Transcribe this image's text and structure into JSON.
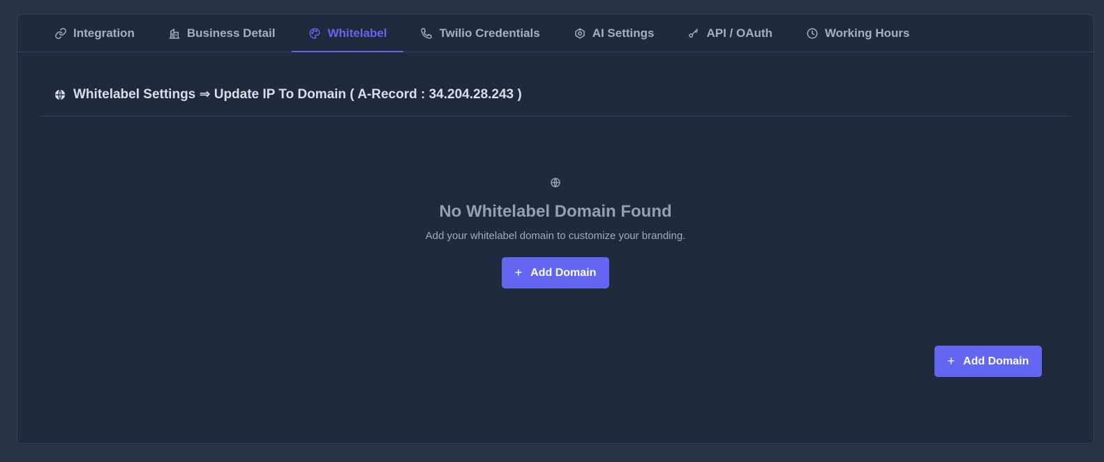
{
  "tabs": [
    {
      "label": "Integration",
      "icon": "link-icon"
    },
    {
      "label": "Business Detail",
      "icon": "building-icon"
    },
    {
      "label": "Whitelabel",
      "icon": "palette-icon"
    },
    {
      "label": "Twilio Credentials",
      "icon": "phone-icon"
    },
    {
      "label": "AI Settings",
      "icon": "robot-icon"
    },
    {
      "label": "API / OAuth",
      "icon": "key-icon"
    },
    {
      "label": "Working Hours",
      "icon": "clock-icon"
    }
  ],
  "active_tab": "Whitelabel",
  "section": {
    "title": "Whitelabel Settings ⇒ Update IP To Domain ( A-Record : 34.204.28.243 )",
    "icon": "globe-icon"
  },
  "empty_state": {
    "icon": "globe-icon",
    "title": "No Whitelabel Domain Found",
    "subtitle": "Add your whitelabel domain to customize your branding.",
    "button_label": "Add Domain"
  },
  "footer_button": {
    "label": "Add Domain"
  },
  "colors": {
    "accent": "#6366f1",
    "background": "#273244",
    "panel": "#1f2a3c"
  }
}
